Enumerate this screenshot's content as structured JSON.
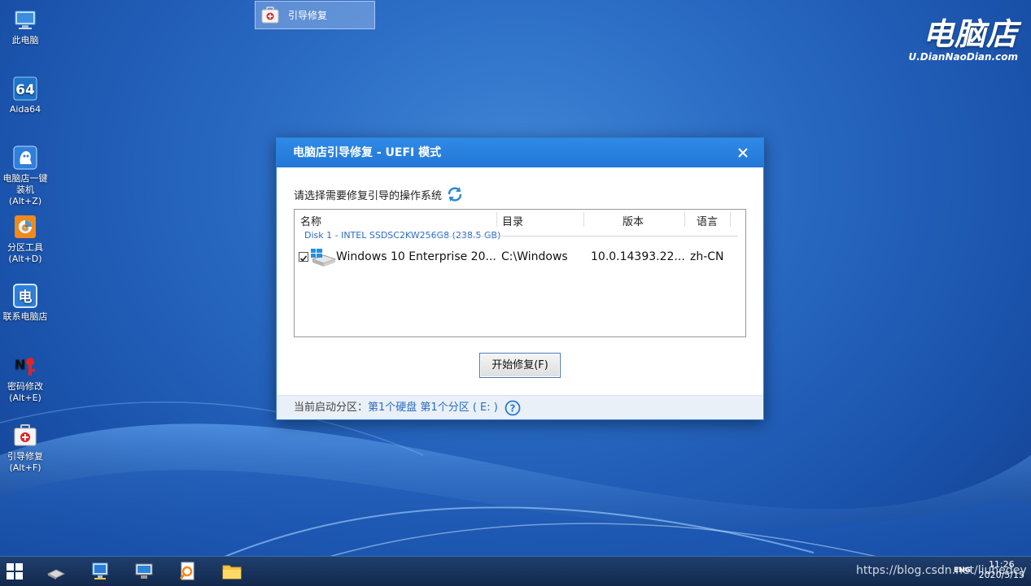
{
  "brand": {
    "logo_text": "电脑店",
    "url_text": "U.DianNaoDian.com"
  },
  "desktop_icons": [
    {
      "label": "此电脑",
      "icon": "computer-icon"
    },
    {
      "label": "Aida64",
      "icon": "aida64-icon"
    },
    {
      "label": "电脑店一键\n装机(Alt+Z)",
      "icon": "installer-icon"
    },
    {
      "label": "分区工具\n(Alt+D)",
      "icon": "partition-tool-icon"
    },
    {
      "label": "联系电脑店",
      "icon": "contact-icon"
    },
    {
      "label": "密码修改\n(Alt+E)",
      "icon": "password-icon"
    },
    {
      "label": "引导修复\n(Alt+F)",
      "icon": "boot-repair-icon"
    }
  ],
  "dialog": {
    "title": "电脑店引导修复 - UEFI 模式",
    "prompt": "请选择需要修复引导的操作系统",
    "columns": [
      "名称",
      "目录",
      "版本",
      "语言"
    ],
    "group_label": "Disk 1 - INTEL SSDSC2KW256G8 (238.5 GB)",
    "rows": [
      {
        "checked": true,
        "name": "Windows 10 Enterprise 20...",
        "dir": "C:\\Windows",
        "version": "10.0.14393.22...",
        "lang": "zh-CN"
      }
    ],
    "start_button": "开始修复(F)",
    "footer_label": "当前启动分区：",
    "footer_value": "第1个硬盘 第1个分区 ( E: )"
  },
  "taskbar": {
    "active_label": "引导修复",
    "watermark": "https://blog.csdn.net/liuhedey",
    "ime": "ENG",
    "time": "11:26",
    "date": "2020/5/15"
  },
  "colors": {
    "accent": "#2377d6",
    "link": "#2a6bc4",
    "desktop": "#2a6bc4"
  }
}
